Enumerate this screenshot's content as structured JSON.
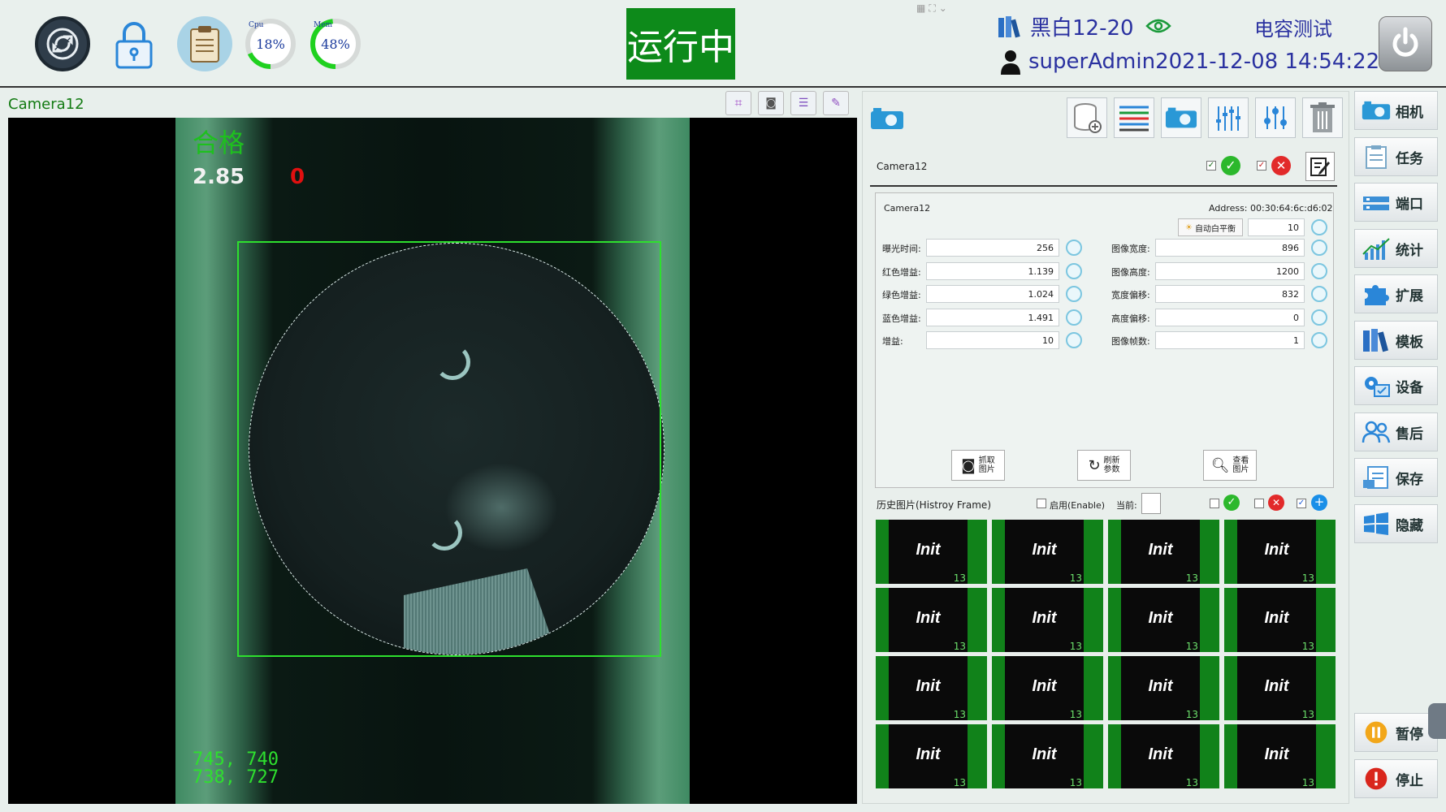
{
  "topbar": {
    "cpu_label": "Cpu",
    "cpu_value": "18%",
    "cpu_fraction": 0.18,
    "mem_label": "Mem",
    "mem_value": "48%",
    "mem_fraction": 0.48,
    "status": "运行中",
    "recipe": "黑白12-20",
    "test_name": "电容测试",
    "user": "superAdmin",
    "datetime": "2021-12-08 14:54:22",
    "status_color": "#0d8a1a"
  },
  "camera_view": {
    "title": "Camera12",
    "result": "合格",
    "ratio": "2.85",
    "ng_count": "0",
    "coord1": "745, 740",
    "coord2": "738, 727",
    "roi_color": "#2ee02e"
  },
  "panel": {
    "camera_name": "Camera12",
    "param_title": "Camera12",
    "address": "Address:  00:30:64:6c:d6:02",
    "awb_label": "自动白平衡",
    "awb_value": "10",
    "left_fields": [
      {
        "label": "曝光时间:",
        "value": "256"
      },
      {
        "label": "红色增益:",
        "value": "1.139"
      },
      {
        "label": "绿色增益:",
        "value": "1.024"
      },
      {
        "label": "蓝色增益:",
        "value": "1.491"
      },
      {
        "label": "增益:",
        "value": "10"
      }
    ],
    "right_fields": [
      {
        "label": "图像宽度:",
        "value": "896"
      },
      {
        "label": "图像高度:",
        "value": "1200"
      },
      {
        "label": "宽度偏移:",
        "value": "832"
      },
      {
        "label": "高度偏移:",
        "value": "0"
      },
      {
        "label": "图像帧数:",
        "value": "1"
      }
    ],
    "actions": [
      {
        "l1": "抓取",
        "l2": "图片"
      },
      {
        "l1": "刷新",
        "l2": "参数"
      },
      {
        "l1": "查看",
        "l2": "图片"
      }
    ],
    "history_label": "历史图片(Histroy Frame)",
    "enable_label": "启用(Enable)",
    "current_label": "当前:",
    "thumb_text": "Init",
    "thumb_num": "13"
  },
  "nav": [
    {
      "label": "相机",
      "icon": "camera-icon"
    },
    {
      "label": "任务",
      "icon": "clipboard-icon"
    },
    {
      "label": "端口",
      "icon": "port-icon"
    },
    {
      "label": "统计",
      "icon": "stats-icon"
    },
    {
      "label": "扩展",
      "icon": "puzzle-icon"
    },
    {
      "label": "模板",
      "icon": "template-icon"
    },
    {
      "label": "设备",
      "icon": "device-gear-icon"
    },
    {
      "label": "售后",
      "icon": "users-icon"
    },
    {
      "label": "保存",
      "icon": "save-icon"
    },
    {
      "label": "隐藏",
      "icon": "windows-icon"
    },
    {
      "label": "暂停",
      "icon": "pause-icon"
    },
    {
      "label": "停止",
      "icon": "stop-icon"
    }
  ]
}
